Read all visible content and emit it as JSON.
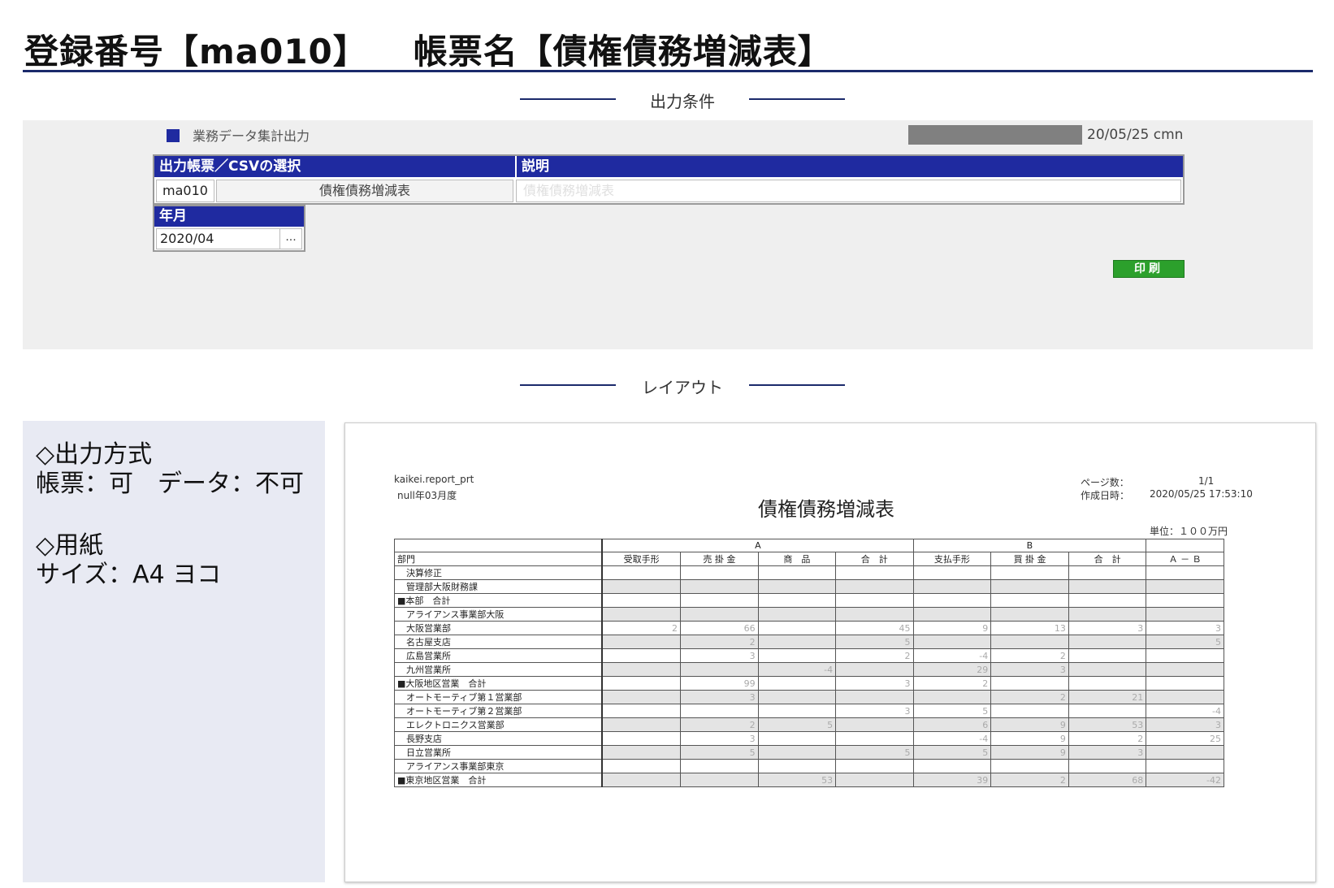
{
  "header": {
    "title_reg": "登録番号【ma010】",
    "title_form": "帳票名【債権債務増減表】"
  },
  "sections": {
    "conditions": "出力条件",
    "layout": "レイアウト"
  },
  "conditions_panel": {
    "app_title": "業務データ集計出力",
    "stamp": "20/05/25 cmn",
    "select_table": {
      "header_select": "出力帳票／CSVの選択",
      "header_desc": "説明",
      "code": "ma010",
      "name": "債権債務増減表",
      "description": "債権債務増減表"
    },
    "year_month": {
      "header": "年月",
      "value": "2020/04",
      "picker_label": "..."
    },
    "print_button": "印刷"
  },
  "info_panel": {
    "output_heading": "◇出力方式",
    "output_value": "帳票：可　データ：不可",
    "paper_heading": "◇用紙",
    "paper_value": "サイズ：A4 ヨコ"
  },
  "report": {
    "program": "kaikei.report_prt",
    "period": "null年03月度",
    "title": "債権債務増減表",
    "page_label": "ページ数：",
    "page_value": "1/1",
    "created_label": "作成日時：",
    "created_value": "2020/05/25 17:53:10",
    "unit": "単位：１００万円",
    "group_a": "A",
    "group_b": "B",
    "columns": [
      "部門",
      "受取手形",
      "売 掛 金",
      "商　品",
      "合　計",
      "支払手形",
      "買 掛 金",
      "合　計",
      "Ａ － Ｂ"
    ],
    "rows": [
      {
        "dept": "決算修正",
        "vals": [
          "",
          "",
          "",
          "",
          "",
          "",
          "",
          ""
        ]
      },
      {
        "dept": "管理部大阪財務課",
        "vals": [
          "",
          "",
          "",
          "",
          "",
          "",
          "",
          ""
        ]
      },
      {
        "dept": "■本部　合計",
        "vals": [
          "",
          "",
          "",
          "",
          "",
          "",
          "",
          ""
        ]
      },
      {
        "dept": "アライアンス事業部大阪",
        "vals": [
          "",
          "",
          "",
          "",
          "",
          "",
          "",
          ""
        ]
      },
      {
        "dept": "大阪営業部",
        "vals": [
          "2",
          "66",
          "",
          "45",
          "9",
          "13",
          "3",
          "3"
        ]
      },
      {
        "dept": "名古屋支店",
        "vals": [
          "",
          "2",
          "",
          "5",
          "",
          "",
          "",
          "5"
        ]
      },
      {
        "dept": "広島営業所",
        "vals": [
          "",
          "3",
          "",
          "2",
          "-4",
          "2",
          "",
          ""
        ]
      },
      {
        "dept": "九州営業所",
        "vals": [
          "",
          "",
          "-4",
          "",
          "29",
          "3",
          "",
          ""
        ]
      },
      {
        "dept": "■大阪地区営業　合計",
        "vals": [
          "",
          "99",
          "",
          "3",
          "2",
          "",
          "",
          ""
        ]
      },
      {
        "dept": "オートモーティブ第１営業部",
        "vals": [
          "",
          "3",
          "",
          "",
          "",
          "2",
          "21",
          ""
        ]
      },
      {
        "dept": "オートモーティブ第２営業部",
        "vals": [
          "",
          "",
          "",
          "3",
          "5",
          "",
          "",
          "-4"
        ]
      },
      {
        "dept": "エレクトロニクス営業部",
        "vals": [
          "",
          "2",
          "5",
          "",
          "6",
          "9",
          "53",
          "3"
        ]
      },
      {
        "dept": "長野支店",
        "vals": [
          "",
          "3",
          "",
          "",
          "-4",
          "9",
          "2",
          "25"
        ]
      },
      {
        "dept": "日立営業所",
        "vals": [
          "",
          "5",
          "",
          "5",
          "5",
          "9",
          "3",
          ""
        ]
      },
      {
        "dept": "アライアンス事業部東京",
        "vals": [
          "",
          "",
          "",
          "",
          "",
          "",
          "",
          ""
        ]
      },
      {
        "dept": "■東京地区営業　合計",
        "vals": [
          "",
          "",
          "53",
          "",
          "39",
          "2",
          "68",
          "-42"
        ]
      }
    ]
  }
}
